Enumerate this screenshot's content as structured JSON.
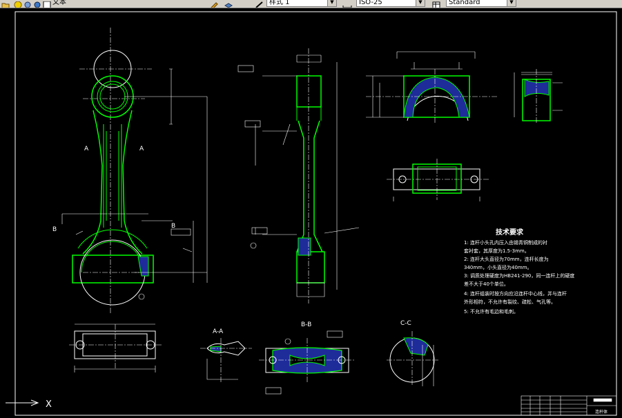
{
  "toolbar": {
    "text_style_label": "文本",
    "layer_combo_value": "样式 1",
    "linetype_combo_value": "ISO-25",
    "dimstyle_combo_value": "Standard"
  },
  "drawing": {
    "view_labels": {
      "section_aa": "A-A",
      "section_bb": "B-B",
      "section_cc": "C-C"
    },
    "cut_marks": {
      "a_left": "A",
      "a_right": "A",
      "b_left": "B",
      "b_right": "B"
    },
    "ucs": {
      "x_label": "X"
    },
    "tech_requirements": {
      "title": "技术要求",
      "lines": [
        "1: 连杆小头孔内压入由锡青铜制成的衬",
        "   套衬套，其厚度为1.5-3mm。",
        "2: 连杆大头直径为70mm，连杆长度为",
        "   340mm，小头直径为40mm。",
        "3: 调质处理硬度为HB241-290，同一连杆上的硬度",
        "   差不大于40个单位。",
        "4: 连杆组装时按方向应沿连杆中心线，并与连杆",
        "   外形相符，不允许有裂纹、疏松、气孔等。",
        "5: 不允许有毛边和毛刺。"
      ]
    },
    "title_block": {
      "part_name": "连杆体"
    }
  },
  "colors": {
    "background": "#000000",
    "outline": "#ffffff",
    "body": "#00ff00",
    "section_fill": "#1e2c9a",
    "text": "#ffffff"
  }
}
